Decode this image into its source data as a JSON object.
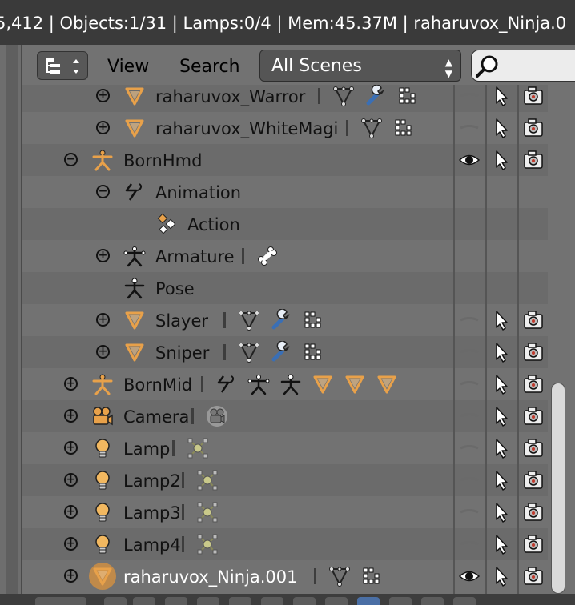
{
  "info_bar": {
    "text": "5,412 | Objects:1/31 | Lamps:0/4 | Mem:45.37M | raharuvox_Ninja.0"
  },
  "header": {
    "view_label": "View",
    "search_label": "Search",
    "scenes_selected": "All Scenes",
    "search_placeholder": ""
  },
  "tree": {
    "rows": [
      {
        "label": "raharuvox_Warror",
        "expand": "+",
        "icon": "mesh-object-icon",
        "depth": 2,
        "children": [
          "mesh-data-icon",
          "modifier-wrench-icon",
          "vertex-groups-icon"
        ],
        "visible": false
      },
      {
        "label": "raharuvox_WhiteMagi",
        "expand": "+",
        "icon": "mesh-object-icon",
        "depth": 2,
        "children": [
          "mesh-data-icon",
          "vertex-groups-icon"
        ],
        "visible": false
      },
      {
        "label": "BornHmd",
        "expand": "−",
        "icon": "armature-object-icon",
        "depth": 1,
        "children": [],
        "visible": true
      },
      {
        "label": "Animation",
        "expand": "−",
        "icon": "animation-icon",
        "depth": 2,
        "children": [],
        "visible": null
      },
      {
        "label": "Action",
        "expand": "",
        "icon": "action-icon",
        "depth": 3,
        "children": [],
        "visible": null
      },
      {
        "label": "Armature",
        "expand": "+",
        "icon": "armature-data-icon",
        "depth": 2,
        "children": [
          "bone-icon"
        ],
        "visible": null
      },
      {
        "label": "Pose",
        "expand": "",
        "icon": "pose-icon",
        "depth": 2,
        "children": [],
        "visible": null
      },
      {
        "label": "Slayer",
        "expand": "+",
        "icon": "mesh-object-icon",
        "depth": 2,
        "children": [
          "mesh-data-icon",
          "modifier-wrench-icon",
          "vertex-groups-icon"
        ],
        "visible": false
      },
      {
        "label": "Sniper",
        "expand": "+",
        "icon": "mesh-object-icon",
        "depth": 2,
        "children": [
          "mesh-data-icon",
          "modifier-wrench-icon",
          "vertex-groups-icon"
        ],
        "visible": false
      },
      {
        "label": "BornMid",
        "expand": "+",
        "icon": "armature-object-icon",
        "depth": 1,
        "children": [
          "animation-icon",
          "armature-data-icon",
          "pose-icon",
          "mesh-object-icon",
          "mesh-object-icon",
          "mesh-object-icon"
        ],
        "visible": false
      },
      {
        "label": "Camera",
        "expand": "+",
        "icon": "camera-object-icon",
        "depth": 1,
        "children": [
          "camera-data-icon"
        ],
        "visible": false
      },
      {
        "label": "Lamp",
        "expand": "+",
        "icon": "lamp-object-icon",
        "depth": 1,
        "children": [
          "lamp-data-icon"
        ],
        "visible": false
      },
      {
        "label": "Lamp2",
        "expand": "+",
        "icon": "lamp-object-icon",
        "depth": 1,
        "children": [
          "lamp-data-icon"
        ],
        "visible": false
      },
      {
        "label": "Lamp3",
        "expand": "+",
        "icon": "lamp-object-icon",
        "depth": 1,
        "children": [
          "lamp-data-icon"
        ],
        "visible": false
      },
      {
        "label": "Lamp4",
        "expand": "+",
        "icon": "lamp-object-icon",
        "depth": 1,
        "children": [
          "lamp-data-icon"
        ],
        "visible": false
      },
      {
        "label": "raharuvox_Ninja.001",
        "expand": "+",
        "icon": "mesh-object-icon",
        "depth": 1,
        "children": [
          "mesh-data-icon",
          "vertex-groups-icon"
        ],
        "visible": true,
        "active": true
      }
    ]
  },
  "colors": {
    "accent_orange": "#e8a14a",
    "selected_text": "#ffffff",
    "row_text": "#111111",
    "header_bg": "#727272",
    "info_bar_bg": "#3a3a3a"
  }
}
